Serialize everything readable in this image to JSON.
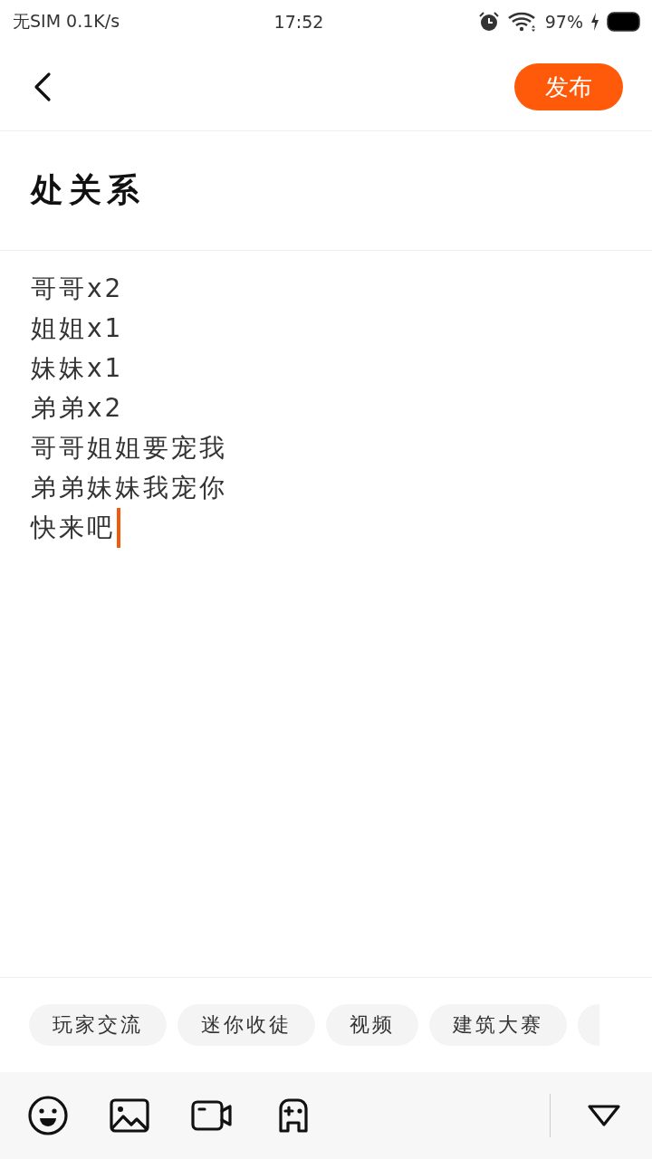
{
  "status_bar": {
    "carrier": "无SIM 0.1K/s",
    "time": "17:52",
    "battery": "97%"
  },
  "header": {
    "publish": "发布"
  },
  "title": "处关系",
  "body": {
    "lines": [
      "哥哥x2",
      "姐姐x1",
      "妹妹x1",
      "弟弟x2",
      "哥哥姐姐要宠我",
      "弟弟妹妹我宠你",
      "快来吧"
    ]
  },
  "topics": [
    {
      "label": "玩家交流"
    },
    {
      "label": "迷你收徒"
    },
    {
      "label": "视频"
    },
    {
      "label": "建筑大赛"
    }
  ]
}
